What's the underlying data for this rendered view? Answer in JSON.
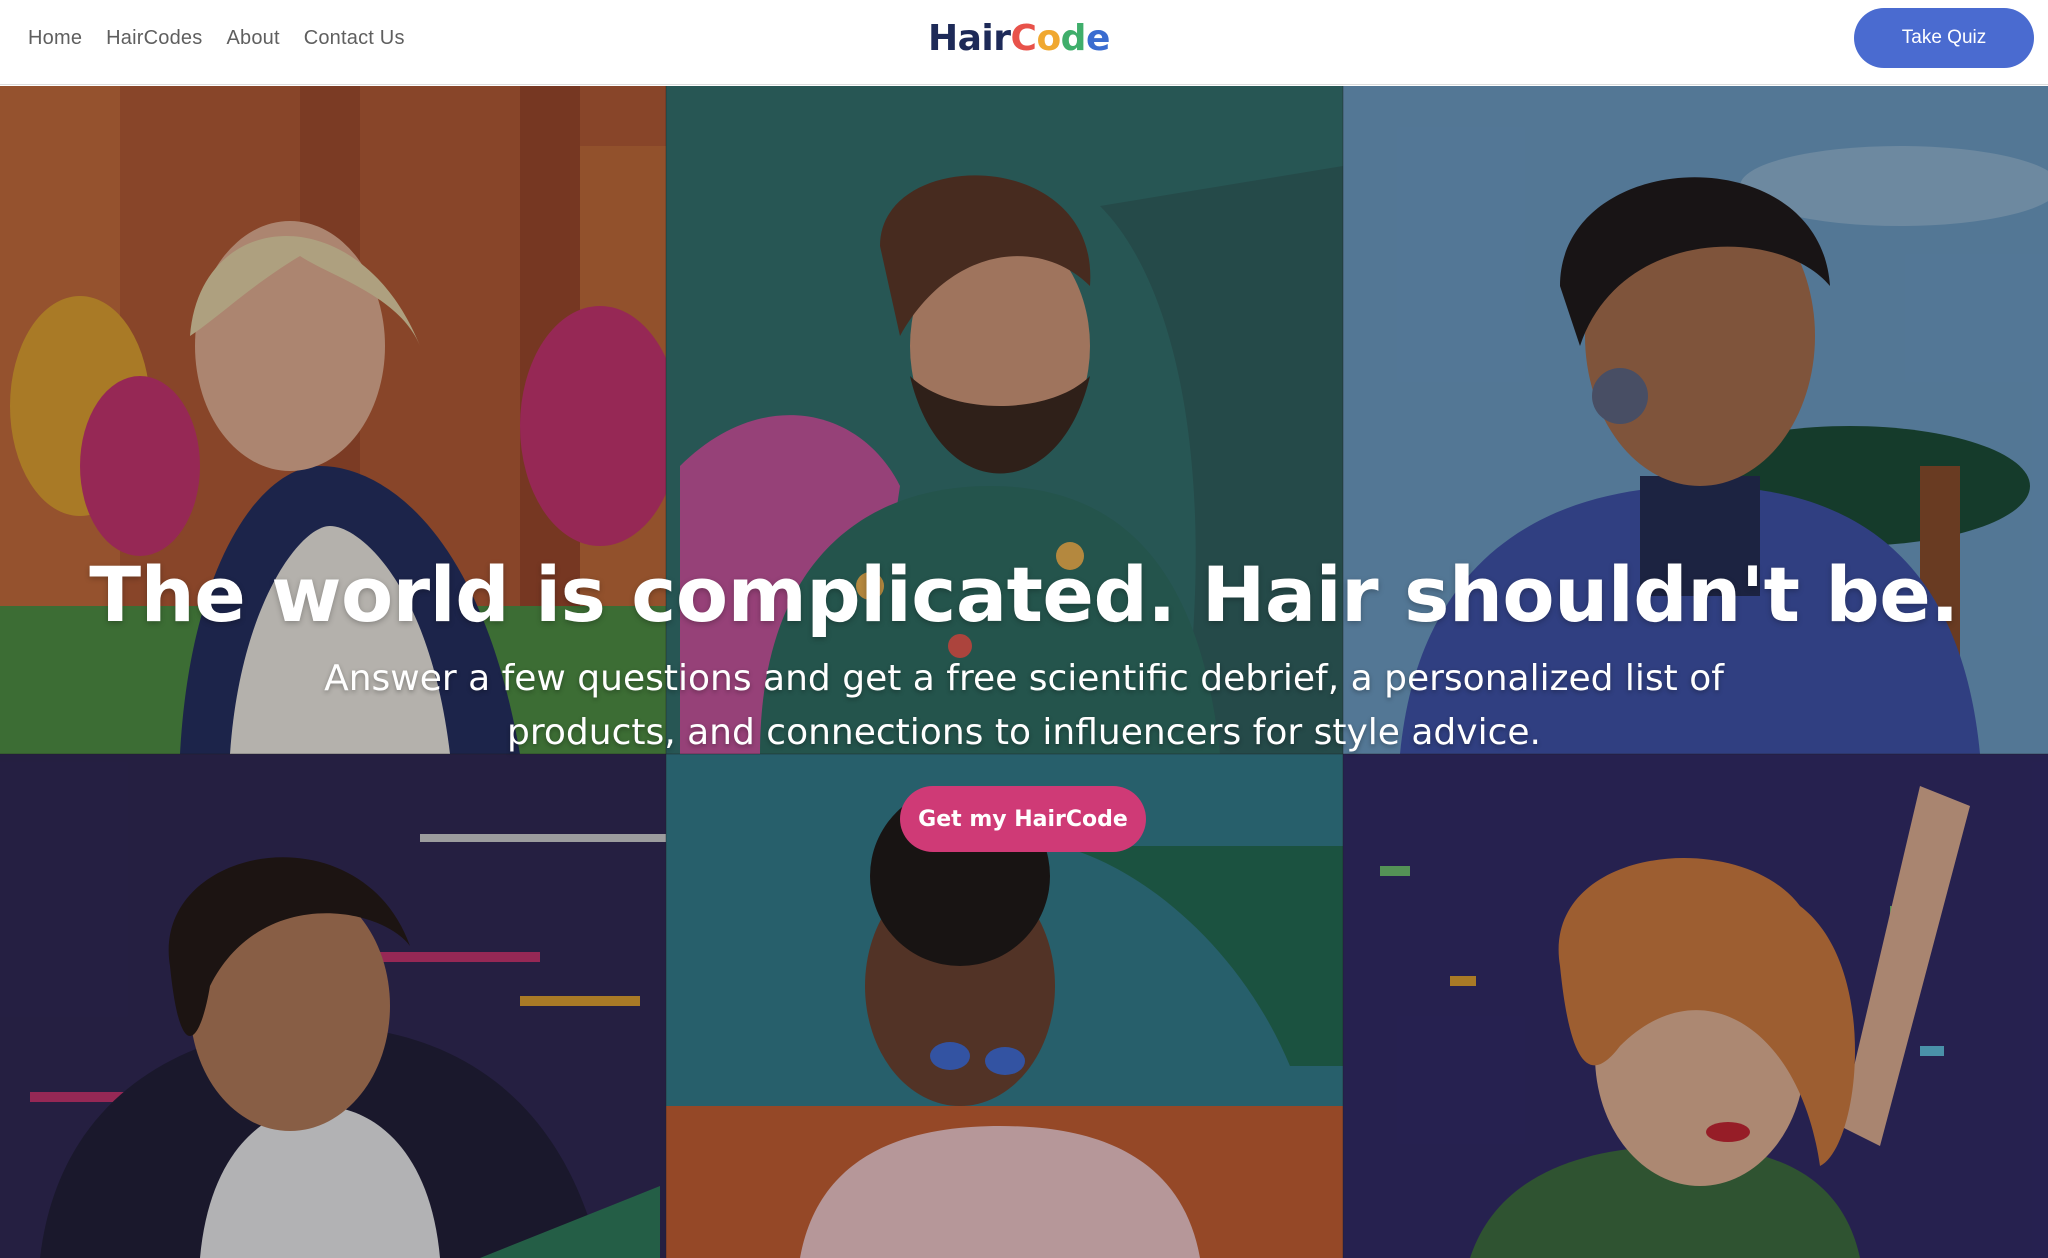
{
  "nav": {
    "items": [
      {
        "label": "Home"
      },
      {
        "label": "HairCodes"
      },
      {
        "label": "About"
      },
      {
        "label": "Contact Us"
      }
    ]
  },
  "brand": {
    "prefix": "Hair",
    "suffix_letters": [
      "C",
      "o",
      "d",
      "e"
    ]
  },
  "header": {
    "quiz_label": "Take Quiz"
  },
  "hero": {
    "headline": "The world is complicated. Hair shouldn't be.",
    "subline": "Answer a few questions and get a free scientific debrief, a personalized list of products, and connections to influencers for style advice.",
    "cta_label": "Get my HairCode"
  },
  "colors": {
    "accent_blue": "#4a6bd0",
    "cta_pink": "#cf3a76",
    "brand_navy": "#1d2a58"
  }
}
